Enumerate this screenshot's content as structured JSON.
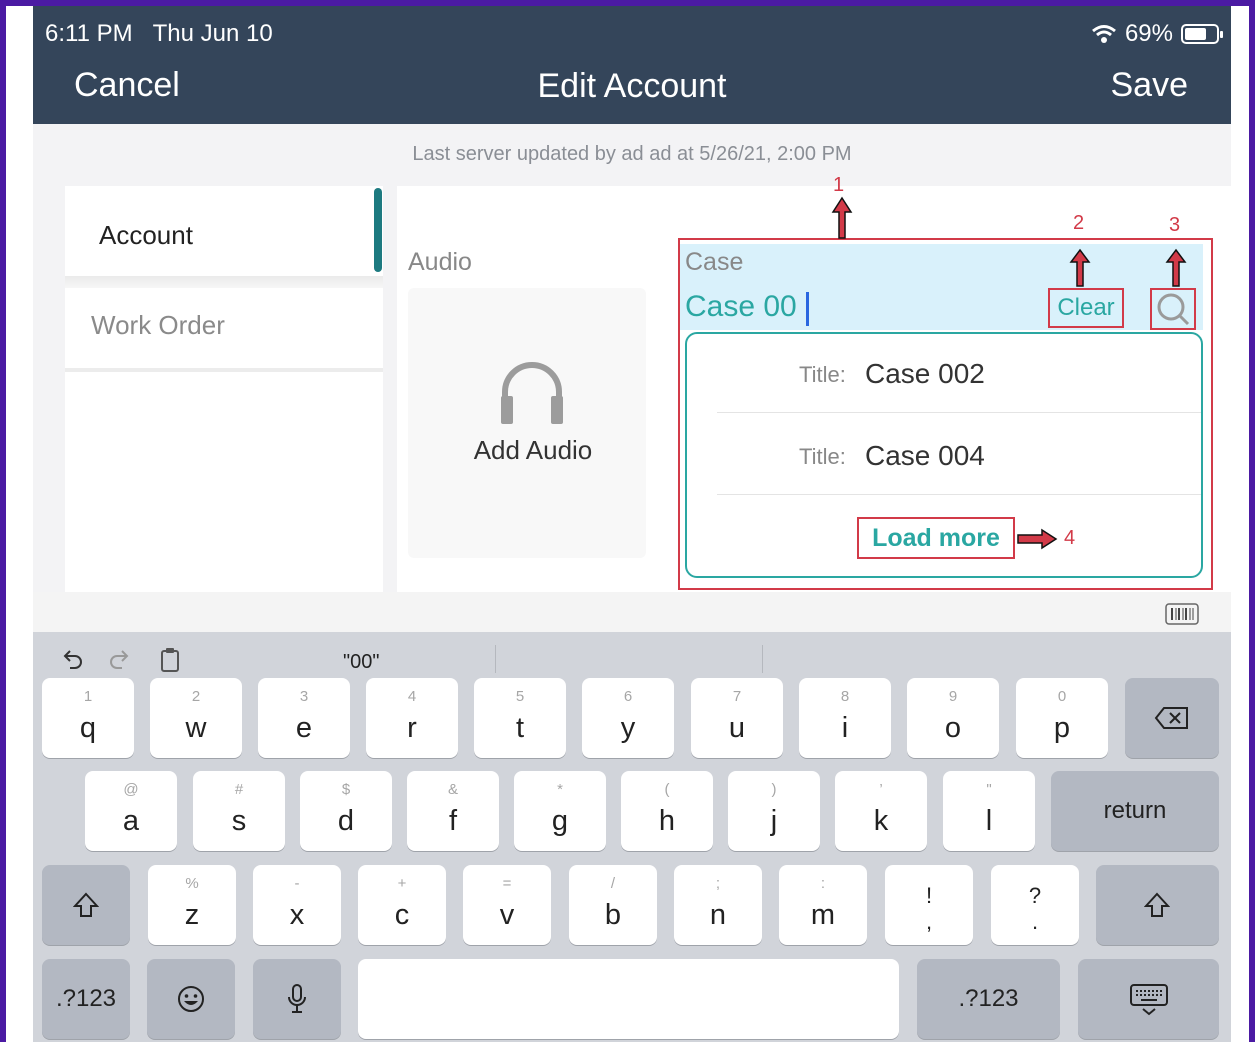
{
  "status_bar": {
    "time": "6:11 PM",
    "date": "Thu Jun 10",
    "battery": "69%",
    "battery_level_fraction": 0.69,
    "wifi_icon": "wifi-icon"
  },
  "nav": {
    "cancel": "Cancel",
    "title": "Edit Account",
    "save": "Save"
  },
  "last_updated": "Last server updated by ad ad at 5/26/21, 2:00 PM",
  "sidebar": {
    "items": [
      {
        "label": "Account",
        "active": true
      },
      {
        "label": "Work Order",
        "active": false
      }
    ]
  },
  "audio": {
    "section_label": "Audio",
    "add_label": "Add Audio",
    "icon": "headphones-icon"
  },
  "case_field": {
    "label": "Case",
    "value": "Case 00",
    "clear_label": "Clear",
    "search_icon": "search-icon"
  },
  "dropdown": {
    "results": [
      {
        "prefix": "Title:",
        "value": "Case 002"
      },
      {
        "prefix": "Title:",
        "value": "Case 004"
      }
    ],
    "load_more": "Load more"
  },
  "annotations": {
    "a1": "1",
    "a2": "2",
    "a3": "3",
    "a4": "4"
  },
  "keyboard": {
    "suggestion": "\"00\"",
    "row1": [
      {
        "sub": "1",
        "key": "q"
      },
      {
        "sub": "2",
        "key": "w"
      },
      {
        "sub": "3",
        "key": "e"
      },
      {
        "sub": "4",
        "key": "r"
      },
      {
        "sub": "5",
        "key": "t"
      },
      {
        "sub": "6",
        "key": "y"
      },
      {
        "sub": "7",
        "key": "u"
      },
      {
        "sub": "8",
        "key": "i"
      },
      {
        "sub": "9",
        "key": "o"
      },
      {
        "sub": "0",
        "key": "p"
      }
    ],
    "row2": [
      {
        "sub": "@",
        "key": "a"
      },
      {
        "sub": "#",
        "key": "s"
      },
      {
        "sub": "$",
        "key": "d"
      },
      {
        "sub": "&",
        "key": "f"
      },
      {
        "sub": "*",
        "key": "g"
      },
      {
        "sub": "(",
        "key": "h"
      },
      {
        "sub": ")",
        "key": "j"
      },
      {
        "sub": "’",
        "key": "k"
      },
      {
        "sub": "\"",
        "key": "l"
      }
    ],
    "row3": [
      {
        "sub": "%",
        "key": "z"
      },
      {
        "sub": "-",
        "key": "x"
      },
      {
        "sub": "+",
        "key": "c"
      },
      {
        "sub": "=",
        "key": "v"
      },
      {
        "sub": "/",
        "key": "b"
      },
      {
        "sub": ";",
        "key": "n"
      },
      {
        "sub": ":",
        "key": "m"
      }
    ],
    "punct1": {
      "top": "!",
      "bottom": ","
    },
    "punct2": {
      "top": "?",
      "bottom": "."
    },
    "return_label": "return",
    "numbers_label": ".?123",
    "backspace_icon": "backspace-icon",
    "shift_icon": "shift-icon",
    "emoji_icon": "emoji-icon",
    "mic_icon": "microphone-icon",
    "hide_keyboard_icon": "hide-keyboard-icon",
    "undo_icon": "undo-icon",
    "redo_icon": "redo-icon",
    "paste_icon": "paste-icon",
    "barcode_icon": "barcode-icon"
  }
}
